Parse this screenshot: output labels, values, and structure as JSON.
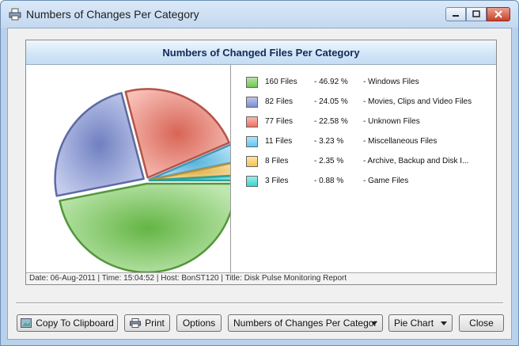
{
  "window": {
    "title": "Numbers of Changes Per Category"
  },
  "chart_data": {
    "type": "pie",
    "title": "Numbers of Changed Files Per Category",
    "slices": [
      {
        "files": "160 Files",
        "value": 46.92,
        "percent": "46.92 %",
        "label": "Windows Files",
        "color": "#6fc94d"
      },
      {
        "files": "82 Files",
        "value": 24.05,
        "percent": "24.05 %",
        "label": "Movies, Clips and Video Files",
        "color": "#7b8ed6"
      },
      {
        "files": "77 Files",
        "value": 22.58,
        "percent": "22.58 %",
        "label": "Unknown Files",
        "color": "#f07060"
      },
      {
        "files": "11 Files",
        "value": 3.23,
        "percent": "3.23 %",
        "label": "Miscellaneous Files",
        "color": "#5fc6f2"
      },
      {
        "files": "8 Files",
        "value": 2.35,
        "percent": "2.35 %",
        "label": "Archive, Backup and Disk I...",
        "color": "#f6c44f"
      },
      {
        "files": "3 Files",
        "value": 0.88,
        "percent": "0.88 %",
        "label": "Game Files",
        "color": "#3ad6d0"
      }
    ],
    "legend_sep": "-"
  },
  "status": {
    "text": "Date: 06-Aug-2011 | Time: 15:04:52 | Host: BonST120 | Title: Disk Pulse Monitoring Report"
  },
  "buttons": {
    "copy": "Copy To Clipboard",
    "print": "Print",
    "options": "Options",
    "category_select": "Numbers of Changes Per Categor",
    "chart_type_select": "Pie Chart",
    "close": "Close"
  }
}
